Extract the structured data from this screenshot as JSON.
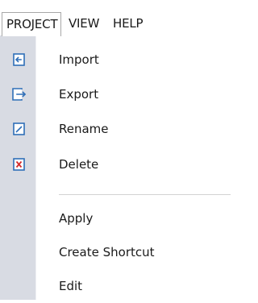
{
  "menubar": {
    "tabs": [
      {
        "label": "PROJECT",
        "active": true
      },
      {
        "label": "VIEW",
        "active": false
      },
      {
        "label": "HELP",
        "active": false
      }
    ]
  },
  "dropdown": {
    "items": [
      {
        "label": "Import",
        "icon": "import-icon"
      },
      {
        "label": "Export",
        "icon": "export-icon"
      },
      {
        "label": "Rename",
        "icon": "rename-icon"
      },
      {
        "label": "Delete",
        "icon": "delete-icon"
      },
      {
        "label": "Apply",
        "icon": null
      },
      {
        "label": "Create Shortcut",
        "icon": null
      },
      {
        "label": "Edit",
        "icon": null
      }
    ]
  },
  "colors": {
    "icon_blue": "#2f6fb8",
    "icon_red": "#d42b2b",
    "gutter": "#d8dbe3"
  }
}
